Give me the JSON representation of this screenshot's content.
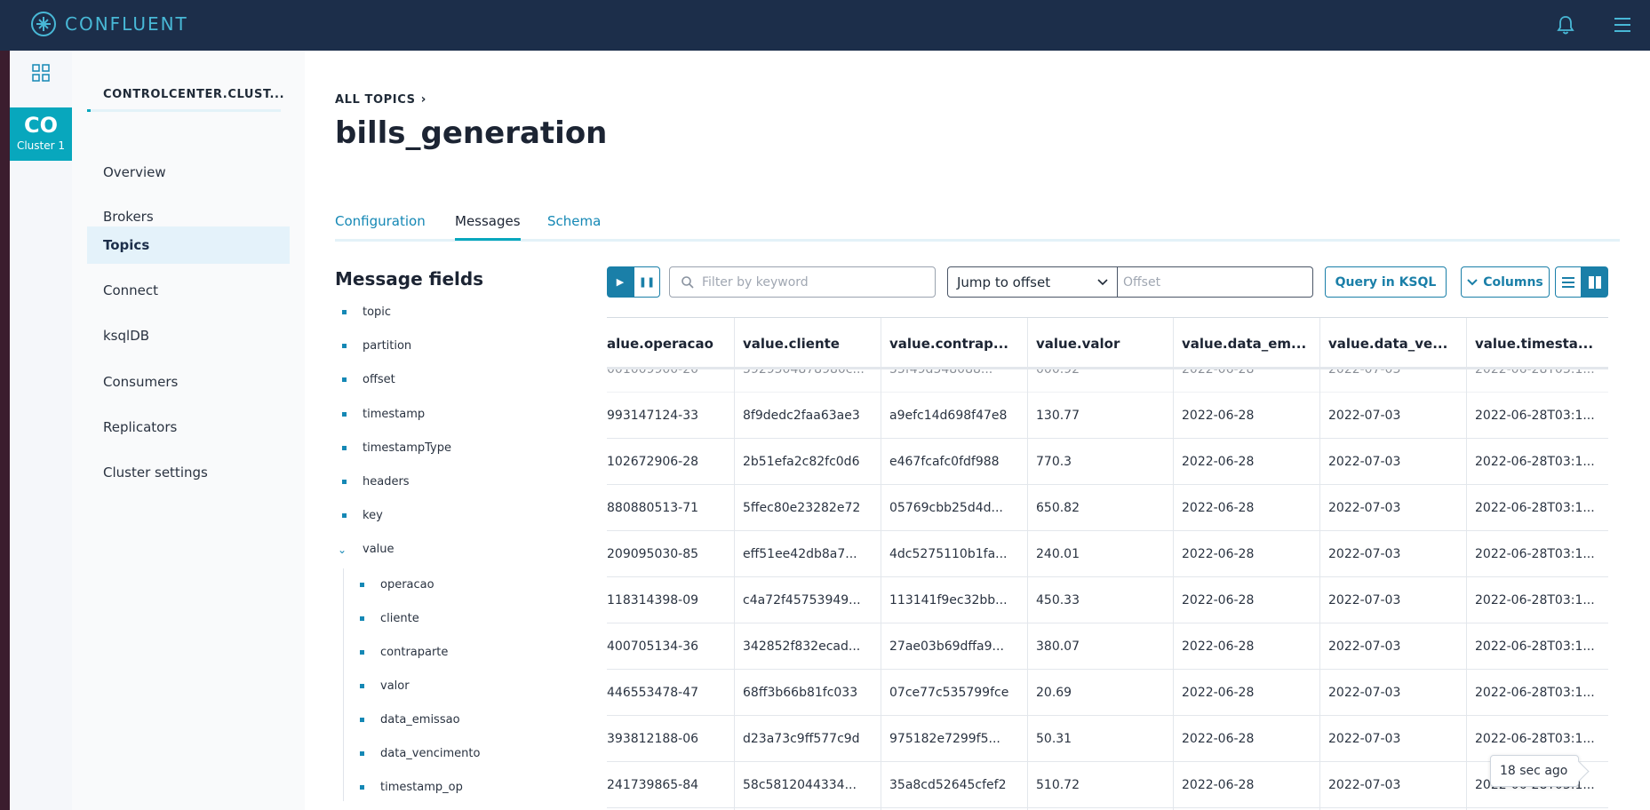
{
  "brand": {
    "name": "CONFLUENT",
    "accent": "#48b8d6",
    "topbar_color": "#1c2e4a"
  },
  "rail": {
    "cluster_abbr": "CO",
    "cluster_name": "Cluster 1"
  },
  "sidebar": {
    "cluster_title": "CONTROLCENTER.CLUST...",
    "items": [
      {
        "label": "Overview",
        "active": false
      },
      {
        "label": "Brokers",
        "active": false
      },
      {
        "label": "Topics",
        "active": true
      },
      {
        "label": "Connect",
        "active": false
      },
      {
        "label": "ksqlDB",
        "active": false
      },
      {
        "label": "Consumers",
        "active": false
      },
      {
        "label": "Replicators",
        "active": false
      },
      {
        "label": "Cluster settings",
        "active": false
      }
    ]
  },
  "breadcrumb": {
    "label": "ALL TOPICS"
  },
  "page_title": "bills_generation",
  "tabs": [
    {
      "label": "Configuration",
      "active": false
    },
    {
      "label": "Messages",
      "active": true
    },
    {
      "label": "Schema",
      "active": false
    }
  ],
  "message_fields": {
    "title": "Message fields",
    "fields": [
      "topic",
      "partition",
      "offset",
      "timestamp",
      "timestampType",
      "headers",
      "key",
      "value"
    ],
    "value_children": [
      "operacao",
      "cliente",
      "contraparte",
      "valor",
      "data_emissao",
      "data_vencimento",
      "timestamp_op"
    ]
  },
  "toolbar": {
    "search_placeholder": "Filter by keyword",
    "jump_label": "Jump to offset",
    "offset_placeholder": "Offset",
    "ksql_label": "Query in KSQL",
    "columns_label": "Columns"
  },
  "table": {
    "headers": [
      "alue.operacao",
      "value.cliente",
      "value.contrap...",
      "value.valor",
      "value.data_em...",
      "value.data_ve...",
      "value.timesta..."
    ],
    "partial_row": [
      "001009900-20",
      "5929504878980c...",
      "55f49d548088...",
      "000.92",
      "2022-06-28",
      "2022-07-03",
      "2022-06-28T03:1..."
    ],
    "rows": [
      [
        "993147124-33",
        "8f9dedc2faa63ae3",
        "a9efc14d698f47e8",
        "130.77",
        "2022-06-28",
        "2022-07-03",
        "2022-06-28T03:1..."
      ],
      [
        "102672906-28",
        "2b51efa2c82fc0d6",
        "e467fcafc0fdf988",
        "770.3",
        "2022-06-28",
        "2022-07-03",
        "2022-06-28T03:1..."
      ],
      [
        "880880513-71",
        "5ffec80e23282e72",
        "05769cbb25d4d...",
        "650.82",
        "2022-06-28",
        "2022-07-03",
        "2022-06-28T03:1..."
      ],
      [
        "209095030-85",
        "eff51ee42db8a7...",
        "4dc5275110b1fa...",
        "240.01",
        "2022-06-28",
        "2022-07-03",
        "2022-06-28T03:1..."
      ],
      [
        "118314398-09",
        "c4a72f45753949...",
        "113141f9ec32bb...",
        "450.33",
        "2022-06-28",
        "2022-07-03",
        "2022-06-28T03:1..."
      ],
      [
        "400705134-36",
        "342852f832ecad...",
        "27ae03b69dffa9...",
        "380.07",
        "2022-06-28",
        "2022-07-03",
        "2022-06-28T03:1..."
      ],
      [
        "446553478-47",
        "68ff3b66b81fc033",
        "07ce77c535799fce",
        "20.69",
        "2022-06-28",
        "2022-07-03",
        "2022-06-28T03:1..."
      ],
      [
        "393812188-06",
        "d23a73c9ff577c9d",
        "975182e7299f5...",
        "50.31",
        "2022-06-28",
        "2022-07-03",
        "2022-06-28T03:1..."
      ],
      [
        "241739865-84",
        "58c5812044334...",
        "35a8cd52645cfef2",
        "510.72",
        "2022-06-28",
        "2022-07-03",
        "2022-06-28T03:1..."
      ]
    ]
  },
  "tooltip": "18 sec ago"
}
